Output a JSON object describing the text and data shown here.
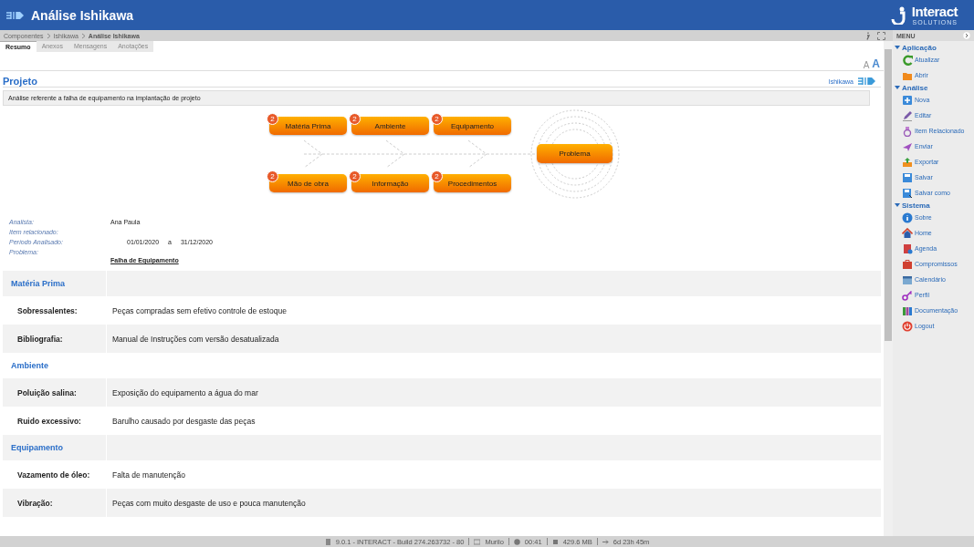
{
  "header": {
    "title": "Análise Ishikawa",
    "brand": "Interact",
    "brand_sub": "SOLUTIONS"
  },
  "breadcrumb": [
    "Componentes",
    "Ishikawa",
    "Análise Ishikawa"
  ],
  "tabs": [
    {
      "label": "Resumo",
      "selected": true
    },
    {
      "label": "Anexos",
      "selected": false
    },
    {
      "label": "Mensagens",
      "selected": false
    },
    {
      "label": "Anotações",
      "selected": false
    }
  ],
  "font_controls": [
    "A",
    "A"
  ],
  "project": {
    "title": "Projeto",
    "link": "Ishikawa",
    "description": "Análise referente a falha de equipamento na implantação de projeto"
  },
  "diagram": {
    "causes_top": [
      {
        "label": "Matéria Prima",
        "count": "2"
      },
      {
        "label": "Ambiente",
        "count": "2"
      },
      {
        "label": "Equipamento",
        "count": "2"
      }
    ],
    "causes_bottom": [
      {
        "label": "Mão de obra",
        "count": "2"
      },
      {
        "label": "Informação",
        "count": "2"
      },
      {
        "label": "Procedimentos",
        "count": "2"
      }
    ],
    "effect": "Problema"
  },
  "fields": [
    {
      "label": "Analista:",
      "value": "Ana Paula"
    },
    {
      "label": "Item relacionado:"
    },
    {
      "label": "Período Analisado:",
      "from": "01/01/2020",
      "sep": "a",
      "to": "31/12/2020"
    },
    {
      "label": "Problema:",
      "link": "Falha de Equipamento"
    }
  ],
  "sections": [
    {
      "name": "Matéria Prima",
      "items": [
        {
          "label": "Sobressalentes:",
          "value": "Peças compradas sem efetivo controle de estoque"
        },
        {
          "label": "Bibliografia:",
          "value": "Manual de Instruções com versão desatualizada"
        }
      ]
    },
    {
      "name": "Ambiente",
      "items": [
        {
          "label": "Poluição salina:",
          "value": "Exposição do equipamento a água do mar"
        },
        {
          "label": "Ruido excessivo:",
          "value": "Barulho causado por desgaste das peças"
        }
      ]
    },
    {
      "name": "Equipamento",
      "items": [
        {
          "label": "Vazamento de óleo:",
          "value": "Falta de manutenção"
        },
        {
          "label": "Vibração:",
          "value": "Peças com muito desgaste de uso e pouca manutenção"
        }
      ]
    }
  ],
  "menu": {
    "title": "MENU",
    "groups": [
      {
        "name": "Aplicação",
        "expanded": true,
        "items": [
          "Atualizar",
          "Abrir"
        ]
      },
      {
        "name": "Análise",
        "expanded": true,
        "items": [
          "Nova",
          "Editar",
          "Item Relacionado",
          "Enviar",
          "Exportar",
          "Salvar",
          "Salvar como"
        ]
      },
      {
        "name": "Sistema",
        "expanded": true,
        "items": [
          "Sobre",
          "Home",
          "Agenda",
          "Compromissos",
          "Calendário",
          "Perfil",
          "Documentação",
          "Logout"
        ]
      }
    ]
  },
  "status_bar": [
    "9.0.1 - INTERACT - Build 274.263732 - 80",
    "Murilo",
    "00:41",
    "429.6 MB",
    "6d 23h 45m"
  ]
}
